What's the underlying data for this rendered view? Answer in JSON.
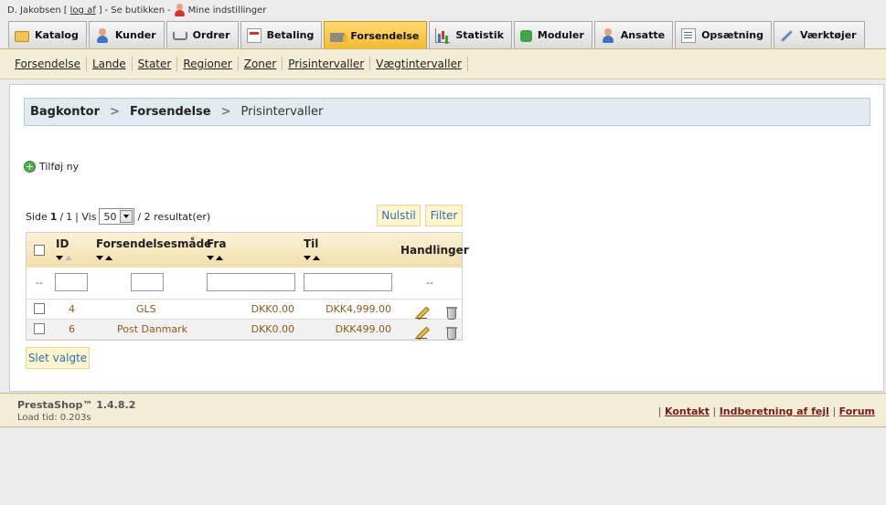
{
  "userbar": {
    "employee_name": "D. Jakobsen",
    "bracket_open": "[",
    "logout_label": "log af",
    "bracket_close": "]",
    "sep1": "-",
    "view_shop_label": "Se butikken",
    "sep2": "-",
    "my_settings_label": "Mine indstillinger"
  },
  "tabs": [
    {
      "label": "Katalog",
      "icon": "folder-icon"
    },
    {
      "label": "Kunder",
      "icon": "user-icon"
    },
    {
      "label": "Ordrer",
      "icon": "cart-icon"
    },
    {
      "label": "Betaling",
      "icon": "payment-icon"
    },
    {
      "label": "Forsendelse",
      "icon": "truck-icon",
      "active": true
    },
    {
      "label": "Statistik",
      "icon": "chart-icon"
    },
    {
      "label": "Moduler",
      "icon": "puzzle-icon"
    },
    {
      "label": "Ansatte",
      "icon": "user-icon"
    },
    {
      "label": "Opsætning",
      "icon": "document-icon"
    },
    {
      "label": "Værktøjer",
      "icon": "wrench-icon"
    }
  ],
  "submenu": [
    "Forsendelse",
    "Lande",
    "Stater",
    "Regioner",
    "Zoner",
    "Prisintervaller",
    "Vægtintervaller"
  ],
  "breadcrumb": {
    "root": "Bagkontor",
    "section": "Forsendelse",
    "current": "Prisintervaller",
    "separator": ">"
  },
  "add_new_label": "Tilføj ny",
  "pager": {
    "page_prefix": "Side",
    "current_page": "1",
    "slash": "/",
    "total_pages": "1",
    "show_label": "| Vis",
    "per_page": "50",
    "results_text": "/ 2 resultat(er)"
  },
  "buttons": {
    "reset": "Nulstil",
    "filter": "Filter",
    "delete_selected": "Slet valgte"
  },
  "table": {
    "columns": {
      "id": "ID",
      "carrier": "Forsendelsesmåde",
      "from": "Fra",
      "to": "Til",
      "actions": "Handlinger"
    },
    "filter_placeholder": "--",
    "rows": [
      {
        "id": "4",
        "carrier": "GLS",
        "from": "DKK0.00",
        "to": "DKK4,999.00"
      },
      {
        "id": "6",
        "carrier": "Post Danmark",
        "from": "DKK0.00",
        "to": "DKK499.00"
      }
    ]
  },
  "footer": {
    "version": "PrestaShop™ 1.4.8.2",
    "load_time": "Load tid: 0.203s",
    "pipe": "|",
    "links": [
      "Kontakt",
      "Indberetning af fejl",
      "Forum"
    ]
  },
  "colors": {
    "active_tab": "#f5bb2d",
    "submenu_bg": "#f3edd6",
    "button_text": "#2a6fb0",
    "row_text": "#8a5a1c",
    "footer_link": "#7a1b1b"
  }
}
